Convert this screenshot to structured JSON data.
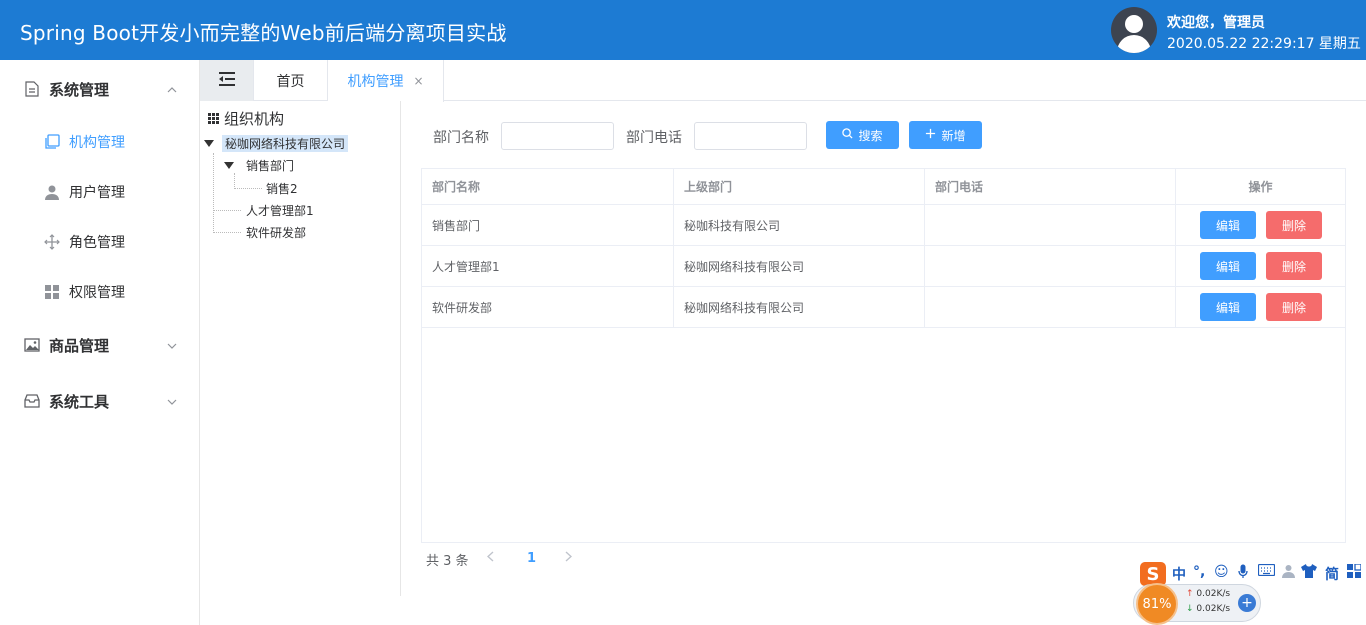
{
  "header": {
    "title": "Spring Boot开发小而完整的Web前后端分离项目实战",
    "welcome": "欢迎您，管理员",
    "datetime": "2020.05.22 22:29:17 星期五"
  },
  "sidebar": {
    "groups": [
      {
        "label": "系统管理",
        "icon": "document-icon",
        "expanded": true,
        "items": [
          {
            "label": "机构管理",
            "icon": "copy-icon",
            "active": true
          },
          {
            "label": "用户管理",
            "icon": "user-icon"
          },
          {
            "label": "角色管理",
            "icon": "move-icon"
          },
          {
            "label": "权限管理",
            "icon": "grid-icon"
          }
        ]
      },
      {
        "label": "商品管理",
        "icon": "picture-icon",
        "expanded": false
      },
      {
        "label": "系统工具",
        "icon": "box-icon",
        "expanded": false
      }
    ]
  },
  "tabs": [
    {
      "label": "首页"
    },
    {
      "label": "机构管理",
      "active": true,
      "closable": true
    }
  ],
  "tree": {
    "title": "组织机构",
    "root": "秘咖网络科技有限公司",
    "children": [
      "销售部门",
      "人才管理部1",
      "软件研发部"
    ],
    "grandchild": "销售2"
  },
  "search": {
    "dept_name_label": "部门名称",
    "dept_phone_label": "部门电话",
    "dept_name_value": "",
    "dept_phone_value": "",
    "search_button": "搜索",
    "add_button": "新增"
  },
  "table": {
    "columns": [
      "部门名称",
      "上级部门",
      "部门电话",
      "操作"
    ],
    "rows": [
      {
        "name": "销售部门",
        "parent": "秘咖科技有限公司",
        "phone": ""
      },
      {
        "name": "人才管理部1",
        "parent": "秘咖网络科技有限公司",
        "phone": ""
      },
      {
        "name": "软件研发部",
        "parent": "秘咖网络科技有限公司",
        "phone": ""
      }
    ],
    "edit_label": "编辑",
    "delete_label": "删除"
  },
  "pagination": {
    "total": "共 3 条",
    "current": "1"
  },
  "ime": {
    "logo": "S",
    "mode": "中",
    "punct": "°,",
    "simplified": "简",
    "cpu": "81%",
    "upload": "0.02K/s",
    "download": "0.02K/s"
  },
  "colors": {
    "header": "#1d7bd3",
    "primary": "#409eff",
    "danger": "#f56c6c"
  }
}
